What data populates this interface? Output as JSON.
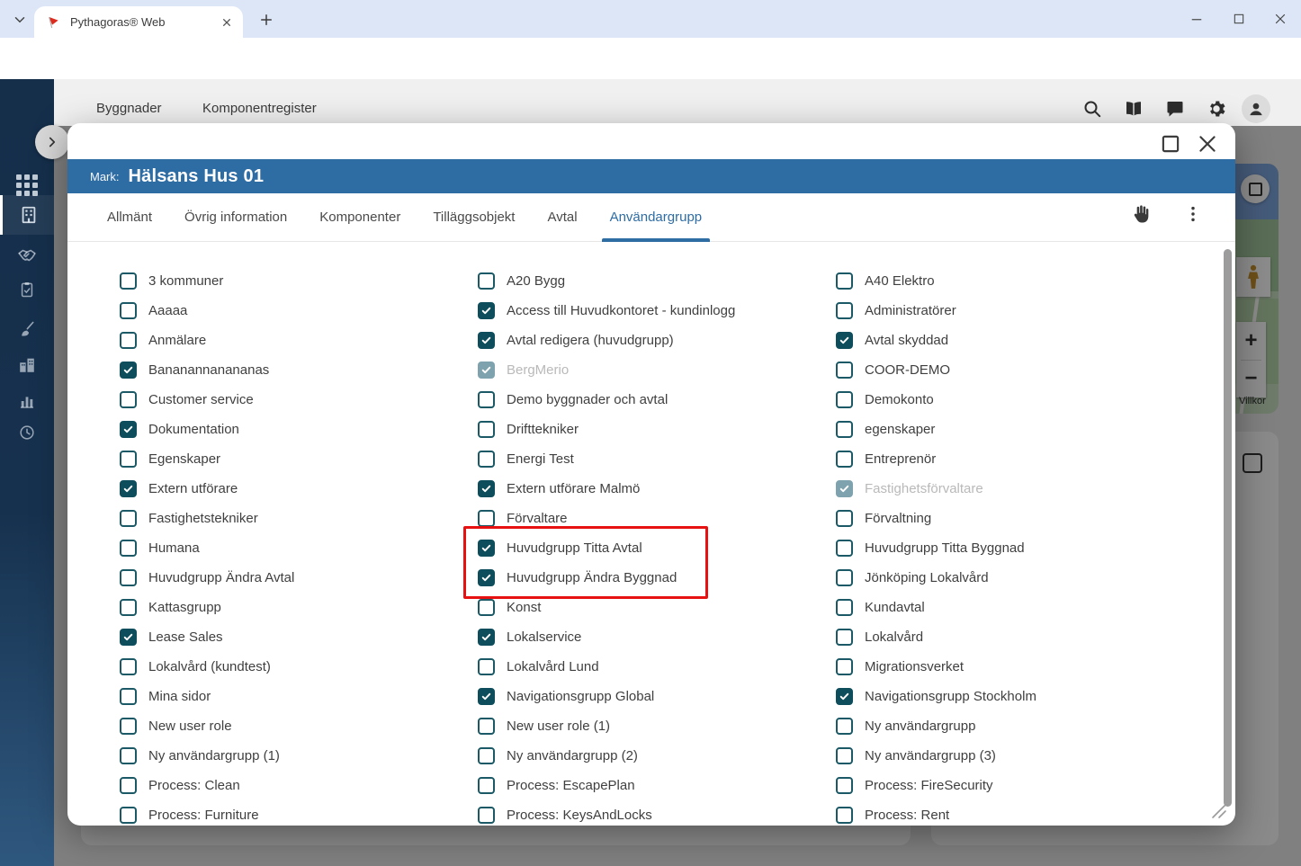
{
  "browser": {
    "tab_title": "Pythagoras® Web",
    "url": "pim.pythagoras.se/py_datamanager_sales/pythagorasweb/index.html?mpMM=BUILDINGS&mpSM=BUILDINGS&oCs=r80i18"
  },
  "app": {
    "menu": [
      "Byggnader",
      "Komponentregister"
    ]
  },
  "modal": {
    "type_label": "Mark:",
    "title": "Hälsans Hus 01",
    "tabs": [
      "Allmänt",
      "Övrig information",
      "Komponenter",
      "Tilläggsobjekt",
      "Avtal",
      "Användargrupp"
    ],
    "active_tab": "Användargrupp",
    "columns": [
      [
        {
          "label": "3 kommuner",
          "checked": false
        },
        {
          "label": "Aaaaa",
          "checked": false
        },
        {
          "label": "Anmälare",
          "checked": false
        },
        {
          "label": "Bananannanananas",
          "checked": true
        },
        {
          "label": "Customer service",
          "checked": false
        },
        {
          "label": "Dokumentation",
          "checked": true
        },
        {
          "label": "Egenskaper",
          "checked": false
        },
        {
          "label": "Extern utförare",
          "checked": true
        },
        {
          "label": "Fastighetstekniker",
          "checked": false
        },
        {
          "label": "Humana",
          "checked": false
        },
        {
          "label": "Huvudgrupp Ändra Avtal",
          "checked": false
        },
        {
          "label": "Kattasgrupp",
          "checked": false
        },
        {
          "label": "Lease Sales",
          "checked": true
        },
        {
          "label": "Lokalvård (kundtest)",
          "checked": false
        },
        {
          "label": "Mina sidor",
          "checked": false
        },
        {
          "label": "New user role",
          "checked": false
        },
        {
          "label": "Ny användargrupp (1)",
          "checked": false
        },
        {
          "label": "Process: Clean",
          "checked": false
        },
        {
          "label": "Process: Furniture",
          "checked": false
        }
      ],
      [
        {
          "label": "A20 Bygg",
          "checked": false
        },
        {
          "label": "Access till Huvudkontoret - kundinlogg",
          "checked": true
        },
        {
          "label": "Avtal redigera (huvudgrupp)",
          "checked": true
        },
        {
          "label": "BergMerio",
          "checked": true,
          "disabled": true
        },
        {
          "label": "Demo byggnader och avtal",
          "checked": false
        },
        {
          "label": "Drifttekniker",
          "checked": false
        },
        {
          "label": "Energi Test",
          "checked": false
        },
        {
          "label": "Extern utförare Malmö",
          "checked": true
        },
        {
          "label": "Förvaltare",
          "checked": false
        },
        {
          "label": "Huvudgrupp Titta Avtal",
          "checked": true
        },
        {
          "label": "Huvudgrupp Ändra Byggnad",
          "checked": true
        },
        {
          "label": "Konst",
          "checked": false
        },
        {
          "label": "Lokalservice",
          "checked": true
        },
        {
          "label": "Lokalvård Lund",
          "checked": false
        },
        {
          "label": "Navigationsgrupp Global",
          "checked": true
        },
        {
          "label": "New user role (1)",
          "checked": false
        },
        {
          "label": "Ny användargrupp (2)",
          "checked": false
        },
        {
          "label": "Process: EscapePlan",
          "checked": false
        },
        {
          "label": "Process: KeysAndLocks",
          "checked": false
        }
      ],
      [
        {
          "label": "A40 Elektro",
          "checked": false
        },
        {
          "label": "Administratörer",
          "checked": false
        },
        {
          "label": "Avtal skyddad",
          "checked": true
        },
        {
          "label": "COOR-DEMO",
          "checked": false
        },
        {
          "label": "Demokonto",
          "checked": false
        },
        {
          "label": "egenskaper",
          "checked": false
        },
        {
          "label": "Entreprenör",
          "checked": false
        },
        {
          "label": "Fastighetsförvaltare",
          "checked": true,
          "disabled": true
        },
        {
          "label": "Förvaltning",
          "checked": false
        },
        {
          "label": "Huvudgrupp Titta Byggnad",
          "checked": false
        },
        {
          "label": "Jönköping Lokalvård",
          "checked": false
        },
        {
          "label": "Kundavtal",
          "checked": false
        },
        {
          "label": "Lokalvård",
          "checked": false
        },
        {
          "label": "Migrationsverket",
          "checked": false
        },
        {
          "label": "Navigationsgrupp Stockholm",
          "checked": true
        },
        {
          "label": "Ny användargrupp",
          "checked": false
        },
        {
          "label": "Ny användargrupp (3)",
          "checked": false
        },
        {
          "label": "Process: FireSecurity",
          "checked": false
        },
        {
          "label": "Process: Rent",
          "checked": false
        }
      ]
    ]
  },
  "map": {
    "terms_label": "Villkor",
    "zoom_in_label": "+",
    "zoom_out_label": "−"
  },
  "colors": {
    "accent_blue": "#2E6CA4",
    "checkbox_teal": "#0E4E5C",
    "checkbox_disabled": "#7FA3AE",
    "annotation_red": "#E71111",
    "sidebar_navy": "#152E4A"
  }
}
